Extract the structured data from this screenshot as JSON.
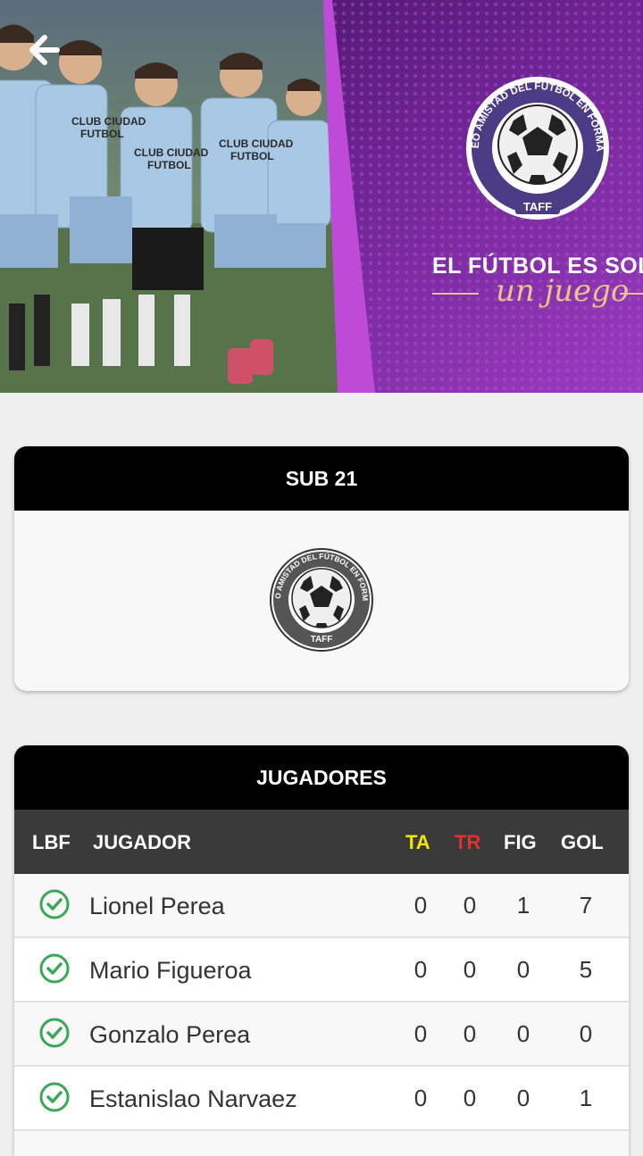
{
  "hero": {
    "slogan_line1": "EL FÚTBOL ES SOL",
    "slogan_line2": "un juego",
    "logo_ring_text": "TORNEO AMISTAD DEL FÚTBOL EN FORMACIÓN",
    "logo_label": "TAFF",
    "shirt_text_1": "CLUB CIUDAD",
    "shirt_text_2": "FUTBOL"
  },
  "category_card": {
    "title": "SUB 21",
    "logo_label": "TAFF",
    "logo_ring_text": "TORNEO AMISTAD DEL FÚTBOL EN FORMACIÓN"
  },
  "players_card": {
    "title": "JUGADORES",
    "columns": {
      "lbf": "LBF",
      "player": "JUGADOR",
      "ta": "TA",
      "tr": "TR",
      "fig": "FIG",
      "gol": "GOL"
    },
    "rows": [
      {
        "name": "Lionel Perea",
        "ta": "0",
        "tr": "0",
        "fig": "1",
        "gol": "7"
      },
      {
        "name": "Mario Figueroa",
        "ta": "0",
        "tr": "0",
        "fig": "0",
        "gol": "5"
      },
      {
        "name": "Gonzalo Perea",
        "ta": "0",
        "tr": "0",
        "fig": "0",
        "gol": "0"
      },
      {
        "name": "Estanislao Narvaez",
        "ta": "0",
        "tr": "0",
        "fig": "0",
        "gol": "1"
      }
    ]
  },
  "colors": {
    "header_black": "#000000",
    "table_header": "#3a3a3a",
    "ta_yellow": "#f2e600",
    "tr_red": "#e53030",
    "check_green": "#3aa856",
    "hero_purple": "#7a2aa0"
  }
}
